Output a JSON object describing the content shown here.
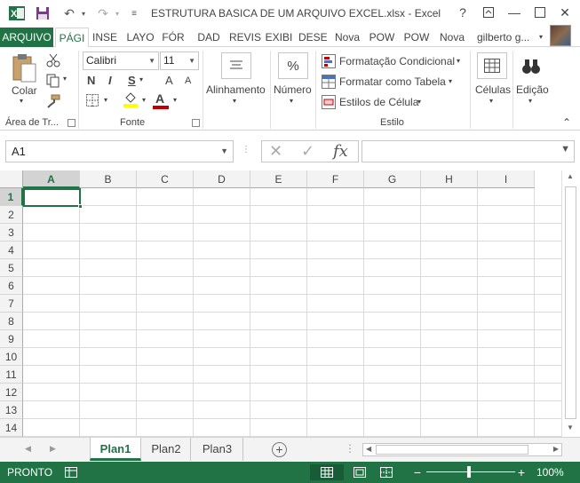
{
  "titlebar": {
    "title": "ESTRUTURA BASICA DE UM ARQUIVO EXCEL.xlsx - Excel",
    "help": "?",
    "minimize": "—",
    "close": "✕"
  },
  "tabs": {
    "file": "ARQUIVO",
    "items": [
      "PÁGI",
      "INSE",
      "LAYO",
      "FÓR",
      "DAD",
      "REVIS",
      "EXIBI",
      "DESE",
      "Nova",
      "POW",
      "POW",
      "Nova"
    ],
    "user": "gilberto g..."
  },
  "ribbon": {
    "clipboard": {
      "paste_label": "Colar",
      "group_label": "Área de Tr..."
    },
    "font": {
      "font_name": "Calibri",
      "font_size": "11",
      "bold": "N",
      "italic": "I",
      "underline": "S",
      "grow": "A",
      "shrink": "A",
      "font_color_letter": "A",
      "group_label": "Fonte"
    },
    "alignment": {
      "label": "Alinhamento"
    },
    "number": {
      "label": "Número",
      "icon_text": "%"
    },
    "styles": {
      "conditional": "Formatação Condicional",
      "as_table": "Formatar como Tabela",
      "cell_styles": "Estilos de Célula",
      "group_label": "Estilo"
    },
    "cells": {
      "label": "Células"
    },
    "editing": {
      "label": "Edição"
    }
  },
  "formula_bar": {
    "name_box": "A1",
    "fx": "fx",
    "value": ""
  },
  "grid": {
    "columns": [
      "A",
      "B",
      "C",
      "D",
      "E",
      "F",
      "G",
      "H",
      "I"
    ],
    "rows": [
      "1",
      "2",
      "3",
      "4",
      "5",
      "6",
      "7",
      "8",
      "9",
      "10",
      "11",
      "12",
      "13",
      "14"
    ],
    "active_cell": "A1"
  },
  "sheets": {
    "tabs": [
      "Plan1",
      "Plan2",
      "Plan3"
    ],
    "active": "Plan1",
    "add": "+"
  },
  "status": {
    "mode": "PRONTO",
    "zoom": "100%",
    "zoom_minus": "−",
    "zoom_plus": "+"
  },
  "colors": {
    "accent": "#217346",
    "font_color_bar": "#c00000",
    "highlight_bar": "#ffff00"
  }
}
